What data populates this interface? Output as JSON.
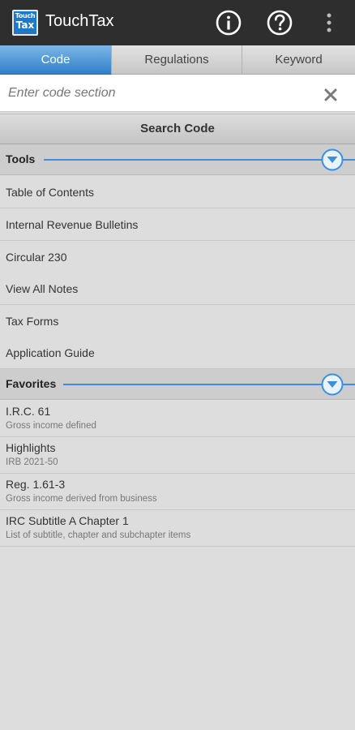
{
  "app": {
    "title": "TouchTax",
    "logo_line1": "Touch",
    "logo_line2": "Tax",
    "icons": [
      "info-icon",
      "help-icon",
      "more-vert-icon"
    ]
  },
  "tabs": [
    {
      "label": "Code",
      "active": true
    },
    {
      "label": "Regulations",
      "active": false
    },
    {
      "label": "Keyword",
      "active": false
    }
  ],
  "search": {
    "placeholder": "Enter code section",
    "value": "",
    "button_label": "Search Code"
  },
  "tools": {
    "header": "Tools",
    "items": [
      "Table of Contents",
      "Internal Revenue Bulletins",
      "Circular 230",
      "View All Notes",
      "Tax Forms",
      "Application Guide"
    ]
  },
  "favorites": {
    "header": "Favorites",
    "items": [
      {
        "title": "I.R.C. 61",
        "subtitle": "Gross income defined"
      },
      {
        "title": "Highlights",
        "subtitle": "IRB 2021-50"
      },
      {
        "title": "Reg. 1.61-3",
        "subtitle": "Gross income derived from business"
      },
      {
        "title": "IRC Subtitle A Chapter 1",
        "subtitle": "List of subtitle, chapter and subchapter items"
      }
    ]
  },
  "colors": {
    "appbar": "#2e2e2e",
    "accent": "#3a8fe0",
    "active_tab": "#2f7fc9",
    "background": "#dddddd"
  }
}
